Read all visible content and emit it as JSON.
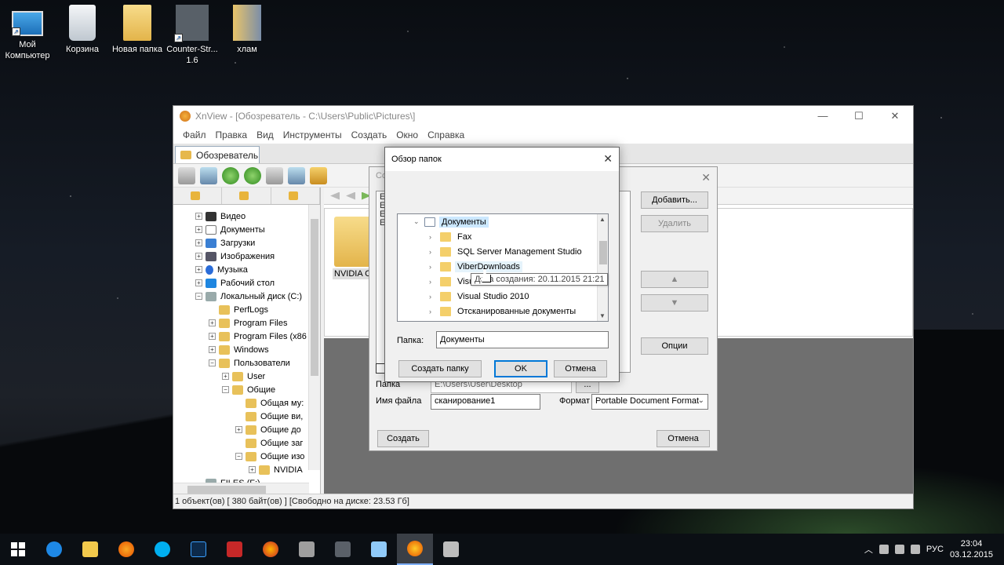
{
  "desktop": {
    "icons": [
      {
        "label": "Мой Компьютер",
        "icon": "computer-icon"
      },
      {
        "label": "Корзина",
        "icon": "recycle-bin-icon"
      },
      {
        "label": "Новая папка",
        "icon": "folder-icon"
      },
      {
        "label": "Counter-Str... 1.6",
        "icon": "game-icon"
      },
      {
        "label": "хлам",
        "icon": "folder-icon"
      }
    ]
  },
  "xnview": {
    "title": "XnView - [Обозреватель - C:\\Users\\Public\\Pictures\\]",
    "menu": [
      "Файл",
      "Правка",
      "Вид",
      "Инструменты",
      "Создать",
      "Окно",
      "Справка"
    ],
    "tab": "Обозреватель",
    "tree": [
      {
        "label": "Видео",
        "exp": "+",
        "icon": "dark",
        "indent": 0
      },
      {
        "label": "Документы",
        "exp": "+",
        "icon": "doc",
        "indent": 0
      },
      {
        "label": "Загрузки",
        "exp": "+",
        "icon": "down",
        "indent": 0
      },
      {
        "label": "Изображения",
        "exp": "+",
        "icon": "img",
        "indent": 0
      },
      {
        "label": "Музыка",
        "exp": "+",
        "icon": "music",
        "indent": 0
      },
      {
        "label": "Рабочий стол",
        "exp": "+",
        "icon": "desk",
        "indent": 0
      },
      {
        "label": "Локальный диск (C:)",
        "exp": "−",
        "icon": "disk",
        "indent": 0
      },
      {
        "label": "PerfLogs",
        "exp": "",
        "icon": "folder",
        "indent": 1
      },
      {
        "label": "Program Files",
        "exp": "+",
        "icon": "folder",
        "indent": 1
      },
      {
        "label": "Program Files (x86",
        "exp": "+",
        "icon": "folder",
        "indent": 1
      },
      {
        "label": "Windows",
        "exp": "+",
        "icon": "folder",
        "indent": 1
      },
      {
        "label": "Пользователи",
        "exp": "−",
        "icon": "folder",
        "indent": 1
      },
      {
        "label": "User",
        "exp": "+",
        "icon": "folder",
        "indent": 2
      },
      {
        "label": "Общие",
        "exp": "−",
        "icon": "folder",
        "indent": 2
      },
      {
        "label": "Общая му:",
        "exp": "",
        "icon": "folder",
        "indent": 3
      },
      {
        "label": "Общие ви,",
        "exp": "",
        "icon": "folder",
        "indent": 3
      },
      {
        "label": "Общие до",
        "exp": "+",
        "icon": "folder",
        "indent": 3
      },
      {
        "label": "Общие заг",
        "exp": "",
        "icon": "folder",
        "indent": 3
      },
      {
        "label": "Общие изо",
        "exp": "−",
        "icon": "folder",
        "indent": 3
      },
      {
        "label": "NVIDIA",
        "exp": "+",
        "icon": "folder",
        "indent": 4
      },
      {
        "label": "FILES (F:)",
        "exp": "",
        "icon": "disk",
        "indent": 0
      }
    ],
    "thumb_label": "NVIDIA C",
    "status": "1 объект(ов) [ 380 байт(ов) ] [Свободно на диске: 23.53 Гб]"
  },
  "create_dialog": {
    "title": "Созд",
    "list_lines": [
      "E",
      "E",
      "E",
      "E"
    ],
    "add_button": "Добавить...",
    "delete_button": "Удалить",
    "options_button": "Опции",
    "folder_label": "Папка",
    "folder_value": "E:\\Users\\User\\Desktop",
    "browse_button": "...",
    "filename_label": "Имя файла",
    "filename_value": "сканирование1",
    "format_label": "Формат",
    "format_value": "Portable Document Format",
    "create_button": "Создать",
    "cancel_button": "Отмена"
  },
  "browse_dialog": {
    "title": "Обзор папок",
    "root": "Документы",
    "folders": [
      {
        "label": "Fax"
      },
      {
        "label": "SQL Server Management Studio"
      },
      {
        "label": "ViberDownloads"
      },
      {
        "label": "Visual"
      },
      {
        "label": "Visual Studio 2010"
      },
      {
        "label": "Отсканированные документы"
      }
    ],
    "tooltip": "Дата создания: 20.11.2015 21:21",
    "folder_label": "Папка:",
    "folder_value": "Документы",
    "new_folder_button": "Создать папку",
    "ok_button": "OK",
    "cancel_button": "Отмена"
  },
  "taskbar": {
    "language": "РУС",
    "time": "23:04",
    "date": "03.12.2015"
  }
}
